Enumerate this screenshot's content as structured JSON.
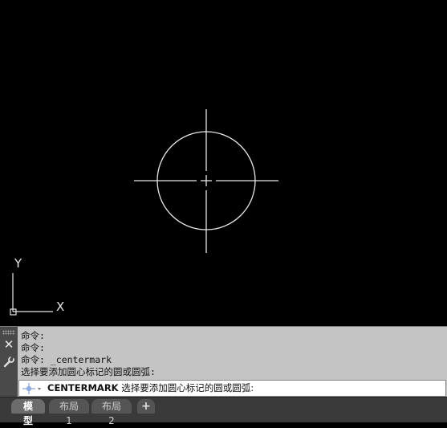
{
  "ucs": {
    "x_label": "X",
    "y_label": "Y"
  },
  "command": {
    "history": [
      "命令:",
      "命令:",
      "命令: _centermark",
      "选择要添加圆心标记的圆或圆弧:"
    ],
    "current_command": "CENTERMARK",
    "current_prompt": " 选择要添加圆心标记的圆或圆弧:"
  },
  "tabs": [
    {
      "label": "模型",
      "active": true
    },
    {
      "label": "布局1",
      "active": false
    },
    {
      "label": "布局2",
      "active": false
    }
  ],
  "add_tab_label": "+",
  "close_label": "✕",
  "colors": {
    "drawing": "#e6e6e6",
    "background": "#000000",
    "panel": "#c4c4c4"
  },
  "icons": [
    "close-icon",
    "wrench-icon",
    "command-icon",
    "add-icon"
  ]
}
